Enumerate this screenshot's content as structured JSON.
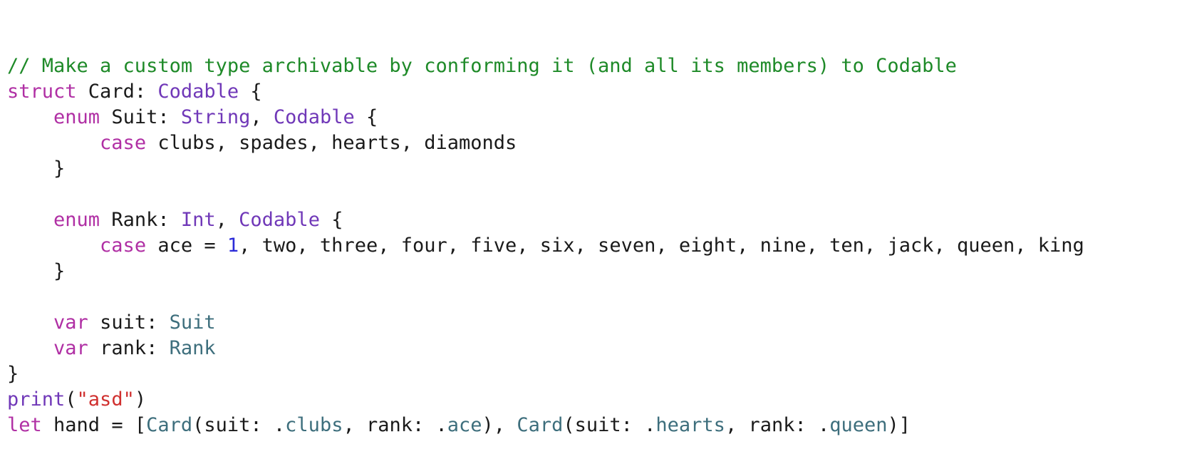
{
  "colors": {
    "background": "#ffffff",
    "comment": "#1e8a28",
    "keyword": "#b02fa4",
    "type": "#7038b8",
    "usertype": "#3d6e7c",
    "number": "#2a2ad8",
    "string": "#d0302f",
    "plain": "#1a1a1a"
  },
  "code": {
    "lines": [
      [
        {
          "kind": "comment",
          "text": "// Make a custom type archivable by conforming it (and all its members) to Codable"
        }
      ],
      [
        {
          "kind": "keyword",
          "text": "struct"
        },
        {
          "kind": "plain",
          "text": " Card: "
        },
        {
          "kind": "type",
          "text": "Codable"
        },
        {
          "kind": "plain",
          "text": " {"
        }
      ],
      [
        {
          "kind": "plain",
          "text": "    "
        },
        {
          "kind": "keyword",
          "text": "enum"
        },
        {
          "kind": "plain",
          "text": " Suit: "
        },
        {
          "kind": "type",
          "text": "String"
        },
        {
          "kind": "plain",
          "text": ", "
        },
        {
          "kind": "type",
          "text": "Codable"
        },
        {
          "kind": "plain",
          "text": " {"
        }
      ],
      [
        {
          "kind": "plain",
          "text": "        "
        },
        {
          "kind": "keyword",
          "text": "case"
        },
        {
          "kind": "plain",
          "text": " clubs, spades, hearts, diamonds"
        }
      ],
      [
        {
          "kind": "plain",
          "text": "    }"
        }
      ],
      [],
      [
        {
          "kind": "plain",
          "text": "    "
        },
        {
          "kind": "keyword",
          "text": "enum"
        },
        {
          "kind": "plain",
          "text": " Rank: "
        },
        {
          "kind": "type",
          "text": "Int"
        },
        {
          "kind": "plain",
          "text": ", "
        },
        {
          "kind": "type",
          "text": "Codable"
        },
        {
          "kind": "plain",
          "text": " {"
        }
      ],
      [
        {
          "kind": "plain",
          "text": "        "
        },
        {
          "kind": "keyword",
          "text": "case"
        },
        {
          "kind": "plain",
          "text": " ace = "
        },
        {
          "kind": "number",
          "text": "1"
        },
        {
          "kind": "plain",
          "text": ", two, three, four, five, six, seven, eight, nine, ten, jack, queen, king"
        }
      ],
      [
        {
          "kind": "plain",
          "text": "    }"
        }
      ],
      [],
      [
        {
          "kind": "plain",
          "text": "    "
        },
        {
          "kind": "keyword",
          "text": "var"
        },
        {
          "kind": "plain",
          "text": " suit: "
        },
        {
          "kind": "usertype",
          "text": "Suit"
        }
      ],
      [
        {
          "kind": "plain",
          "text": "    "
        },
        {
          "kind": "keyword",
          "text": "var"
        },
        {
          "kind": "plain",
          "text": " rank: "
        },
        {
          "kind": "usertype",
          "text": "Rank"
        }
      ],
      [
        {
          "kind": "plain",
          "text": "}"
        }
      ],
      [
        {
          "kind": "type",
          "text": "print"
        },
        {
          "kind": "plain",
          "text": "("
        },
        {
          "kind": "string",
          "text": "\"asd\""
        },
        {
          "kind": "plain",
          "text": ")"
        }
      ],
      [
        {
          "kind": "keyword",
          "text": "let"
        },
        {
          "kind": "plain",
          "text": " hand = ["
        },
        {
          "kind": "usertype",
          "text": "Card"
        },
        {
          "kind": "plain",
          "text": "(suit: ."
        },
        {
          "kind": "usertype",
          "text": "clubs"
        },
        {
          "kind": "plain",
          "text": ", rank: ."
        },
        {
          "kind": "usertype",
          "text": "ace"
        },
        {
          "kind": "plain",
          "text": "), "
        },
        {
          "kind": "usertype",
          "text": "Card"
        },
        {
          "kind": "plain",
          "text": "(suit: ."
        },
        {
          "kind": "usertype",
          "text": "hearts"
        },
        {
          "kind": "plain",
          "text": ", rank: ."
        },
        {
          "kind": "usertype",
          "text": "queen"
        },
        {
          "kind": "plain",
          "text": ")]"
        }
      ]
    ]
  }
}
